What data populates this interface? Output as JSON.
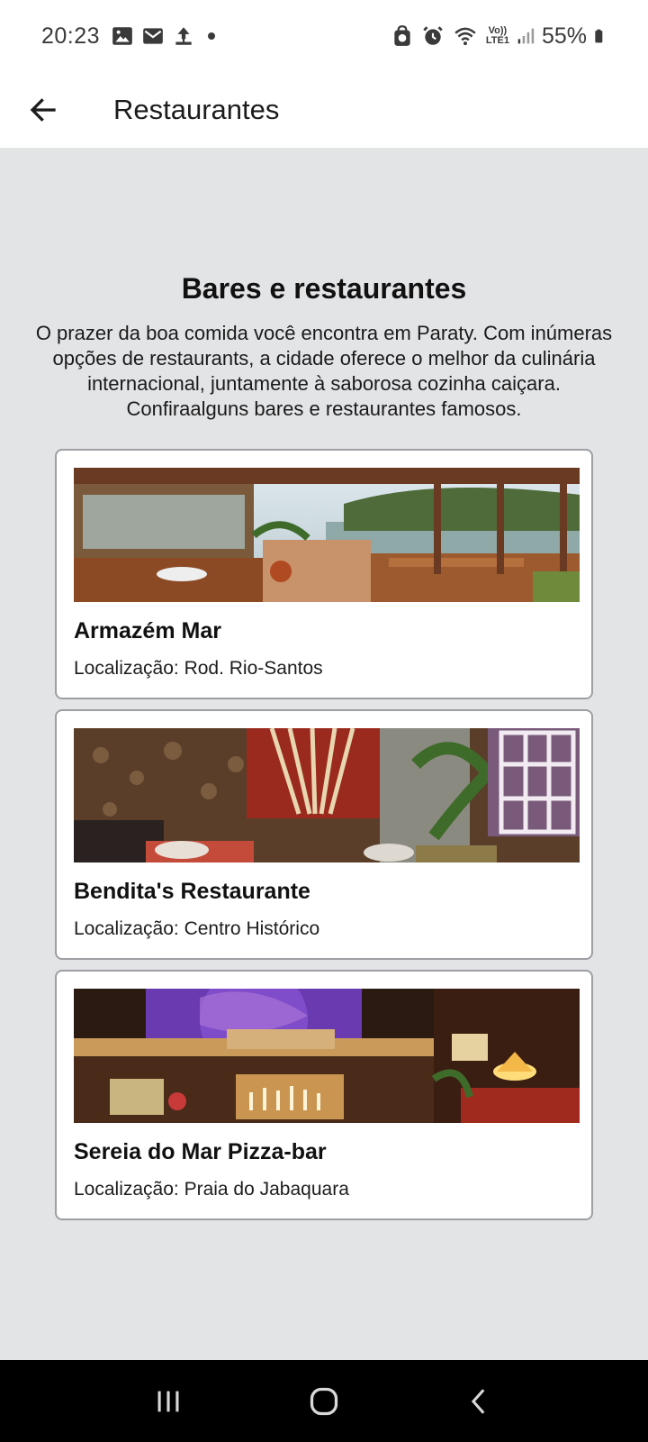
{
  "status_bar": {
    "time": "20:23",
    "battery": "55%",
    "icons_left": [
      "image-icon",
      "mail-icon",
      "download-icon",
      "dot"
    ],
    "icons_right": [
      "bag-icon",
      "alarm-icon",
      "wifi-icon",
      "volte-icon",
      "signal-icon",
      "battery-icon"
    ],
    "volte_top": "Vo))",
    "volte_bottom": "LTE1"
  },
  "app_bar": {
    "title": "Restaurantes",
    "back_icon": "arrow-left-icon"
  },
  "section": {
    "title": "Bares e restaurantes",
    "description": "O prazer da boa comida você encontra em Paraty. Com inúmeras opções de restaurants, a cidade oferece o melhor da culinária internacional, juntamente à saborosa cozinha caiçara. Confiraalguns bares e restaurantes famosos."
  },
  "restaurants": [
    {
      "name": "Armazém Mar",
      "location": "Localização: Rod. Rio-Santos"
    },
    {
      "name": "Bendita's Restaurante",
      "location": "Localização: Centro Histórico"
    },
    {
      "name": "Sereia do Mar Pizza-bar",
      "location": "Localização: Praia do Jabaquara"
    }
  ],
  "nav_bar": {
    "buttons": [
      "recent-apps-icon",
      "home-icon",
      "back-icon"
    ]
  },
  "colors": {
    "background": "#e3e4e6",
    "card_border": "#9d9fa3",
    "nav_bar": "#000000"
  }
}
